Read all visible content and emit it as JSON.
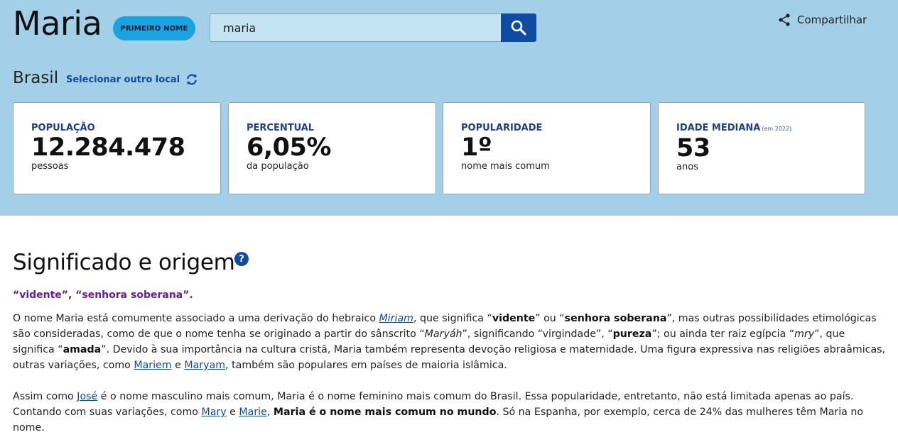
{
  "header": {
    "name": "Maria",
    "badge": "PRIMEIRO NOME",
    "search_value": "maria",
    "search_icon": "magnifier-icon",
    "share_label": "Compartilhar",
    "share_icon": "share-icon"
  },
  "location": {
    "name": "Brasil",
    "change_label": "Selecionar outro local",
    "change_icon": "refresh-icon"
  },
  "stats": [
    {
      "label": "POPULAÇÃO",
      "note": "",
      "value": "12.284.478",
      "sub": "pessoas"
    },
    {
      "label": "PERCENTUAL",
      "note": "",
      "value": "6,05%",
      "sub": "da população"
    },
    {
      "label": "POPULARIDADE",
      "note": "",
      "value": "1º",
      "sub": "nome mais comum"
    },
    {
      "label": "IDADE MEDIANA",
      "note": "(em 2022)",
      "value": "53",
      "sub": "anos"
    }
  ],
  "section": {
    "title": "Significado e origem",
    "help_icon": "question-icon",
    "meaning": "“vidente”, “senhora soberana”.",
    "p1": {
      "t1": "O nome Maria está comumente associado a uma derivação do hebraico ",
      "link_miriam": "Miriam",
      "t2": ", que significa “",
      "b_vidente": "vidente",
      "t3": "” ou “",
      "b_senhora": "senhora soberana",
      "t4": "”, mas outras possibilidades etimológicas são consideradas, como de que o nome tenha se originado a partir do sânscrito “",
      "i_maryah": "Maryáh",
      "t5": "”, significando “virgindade”, “",
      "b_pureza": "pureza",
      "t6": "”; ou ainda ter raiz egípcia “",
      "i_mry": "mry",
      "t7": "”, que significa “",
      "b_amada": "amada",
      "t8": "”. Devido à sua importância na cultura cristã, Maria também representa devoção religiosa e maternidade. Uma figura expressiva nas religiões abraâmicas, outras variações, como ",
      "link_mariem": "Mariem",
      "t9": " e ",
      "link_maryam": "Maryam",
      "t10": ", também são populares em países de maioria islâmica."
    },
    "p2": {
      "t1": "Assim como ",
      "link_jose": "José",
      "t2": " é o nome masculino mais comum, Maria é o nome feminino mais comum do Brasil. Essa popularidade, entretanto, não está limitada apenas ao país. Contando com suas variações, como ",
      "link_mary": "Mary",
      "t3": " e ",
      "link_marie": "Marie",
      "t4": ", ",
      "b_mundo": "Maria é o nome mais comum no mundo",
      "t5": ". Só na Espanha, por exemplo, cerca de 24% das mulheres têm Maria no nome."
    }
  },
  "colors": {
    "hero_bg": "#a3cfe8",
    "accent": "#0f4aa3",
    "badge_bg": "#1aa3e0",
    "meaning": "#6b1b9e"
  }
}
